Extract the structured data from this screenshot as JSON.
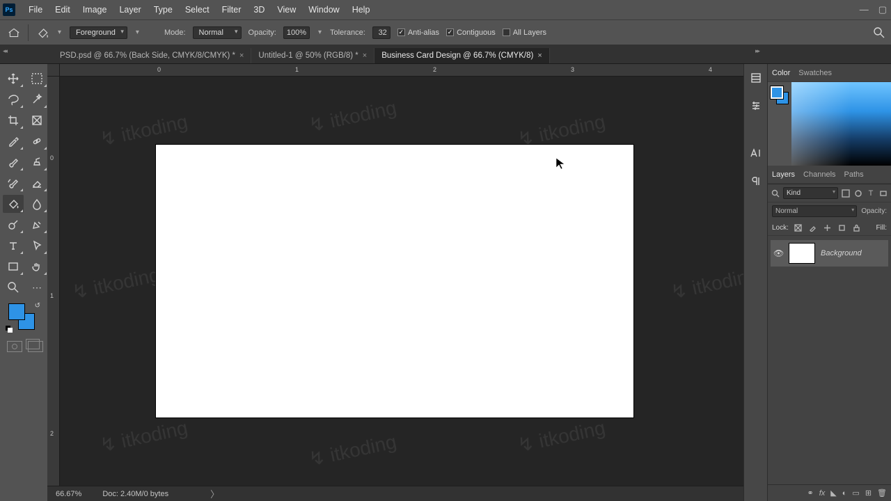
{
  "app_badge": "Ps",
  "menus": [
    "File",
    "Edit",
    "Image",
    "Layer",
    "Type",
    "Select",
    "Filter",
    "3D",
    "View",
    "Window",
    "Help"
  ],
  "options": {
    "fill_source": "Foreground",
    "mode_label": "Mode:",
    "mode_value": "Normal",
    "opacity_label": "Opacity:",
    "opacity_value": "100%",
    "tolerance_label": "Tolerance:",
    "tolerance_value": "32",
    "antialias_label": "Anti-alias",
    "antialias_checked": true,
    "contiguous_label": "Contiguous",
    "contiguous_checked": true,
    "alllayers_label": "All Layers",
    "alllayers_checked": false
  },
  "tabs": [
    {
      "label": "PSD.psd @ 66.7% (Back Side, CMYK/8/CMYK) *"
    },
    {
      "label": "Untitled-1 @ 50% (RGB/8) *"
    },
    {
      "label": "Business Card Design @ 66.7% (CMYK/8)"
    }
  ],
  "active_tab": 2,
  "rulers": {
    "h": [
      "0",
      "1",
      "2",
      "3",
      "4"
    ],
    "v": [
      "0",
      "1",
      "2"
    ]
  },
  "status": {
    "zoom": "66.67%",
    "doc": "Doc: 2.40M/0 bytes"
  },
  "panels": {
    "color_tabs": [
      "Color",
      "Swatches"
    ],
    "layers_tabs": [
      "Layers",
      "Channels",
      "Paths"
    ],
    "kind_placeholder": "Kind",
    "blend_mode": "Normal",
    "opacity_label": "Opacity:",
    "lock_label": "Lock:",
    "fill_label": "Fill:",
    "layer_name": "Background"
  },
  "watermark": "itkoding"
}
